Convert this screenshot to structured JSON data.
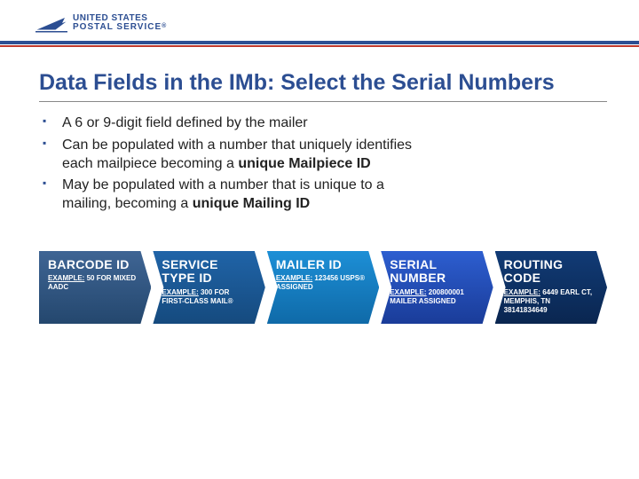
{
  "brand": {
    "line1": "UNITED STATES",
    "line2": "POSTAL SERVICE",
    "mark": "®"
  },
  "title": "Data Fields in the IMb: Select the Serial Numbers",
  "bullets": [
    {
      "text": "A 6 or 9-digit field defined by the mailer"
    },
    {
      "text": "Can be populated with a number that uniquely identifies each mailpiece becoming a ",
      "bold": "unique Mailpiece ID"
    },
    {
      "text": "May be populated with a number that is unique to a mailing, becoming a ",
      "bold": "unique Mailing ID"
    }
  ],
  "fields": [
    {
      "title": "BARCODE ID",
      "example_label": "EXAMPLE:",
      "example": " 50 FOR MIXED AADC"
    },
    {
      "title": "SERVICE TYPE ID",
      "example_label": "EXAMPLE:",
      "example": " 300 FOR FIRST-CLASS MAIL®"
    },
    {
      "title": "MAILER ID",
      "example_label": "EXAMPLE:",
      "example": " 123456 USPS® ASSIGNED"
    },
    {
      "title": "SERIAL NUMBER",
      "example_label": "EXAMPLE:",
      "example": " 200800001 MAILER ASSIGNED"
    },
    {
      "title": "ROUTING CODE",
      "example_label": "EXAMPLE:",
      "example": " 6449 EARL CT, MEMPHIS, TN 38141834649"
    }
  ]
}
